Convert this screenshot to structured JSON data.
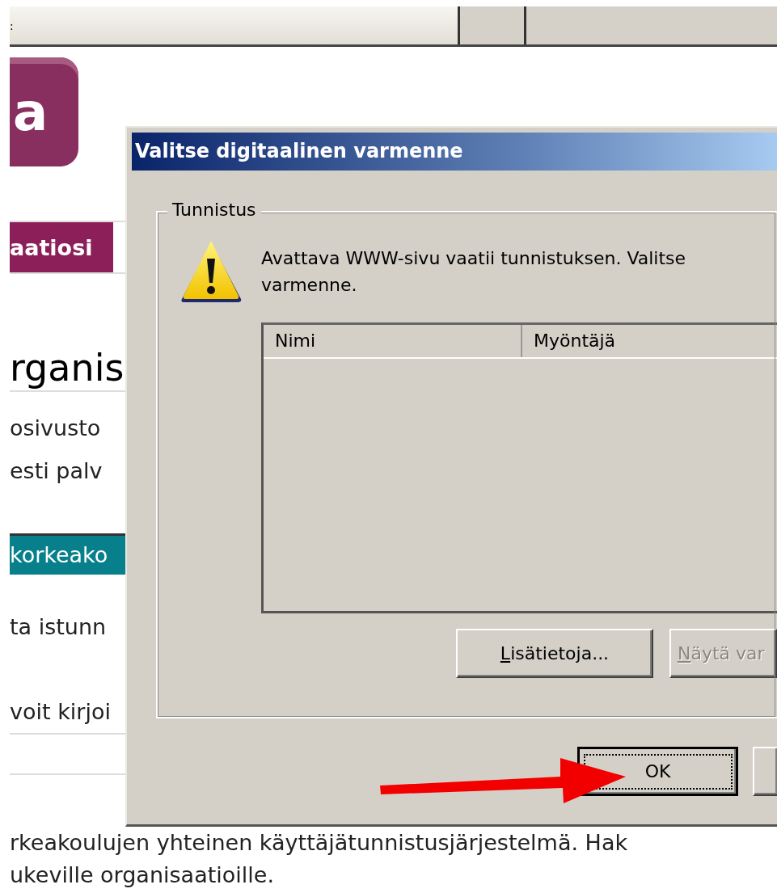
{
  "toolbar": {
    "text": ":"
  },
  "page": {
    "logo_letter": "a",
    "nav_tab": {
      "label": "aatiosi",
      "selected": true
    },
    "heading": "rganis",
    "intro_lines": [
      "osivusto",
      "esti palv"
    ],
    "section_bar": "korkeako",
    "text_1": "ta istunn",
    "text_2": "voit kirjoi",
    "footer_lines": [
      "rkeakoulujen yhteinen käyttäjätunnistusjärjestelmä. Hak",
      "ukeville organisaatioille."
    ]
  },
  "dialog": {
    "title": "Valitse digitaalinen varmenne",
    "group_label": "Tunnistus",
    "message": "Avattava WWW-sivu vaatii tunnistuksen. Valitse varmenne.",
    "list_columns": [
      "Nimi",
      "Myöntäjä"
    ],
    "buttons": [
      {
        "label": "Lisätietoja...",
        "disabled": false
      },
      {
        "label": "Näytä var",
        "disabled": true
      }
    ],
    "ok_button": {
      "label": "OK",
      "default": true
    },
    "cut_button": true
  },
  "annotation": {
    "arrow": true
  }
}
